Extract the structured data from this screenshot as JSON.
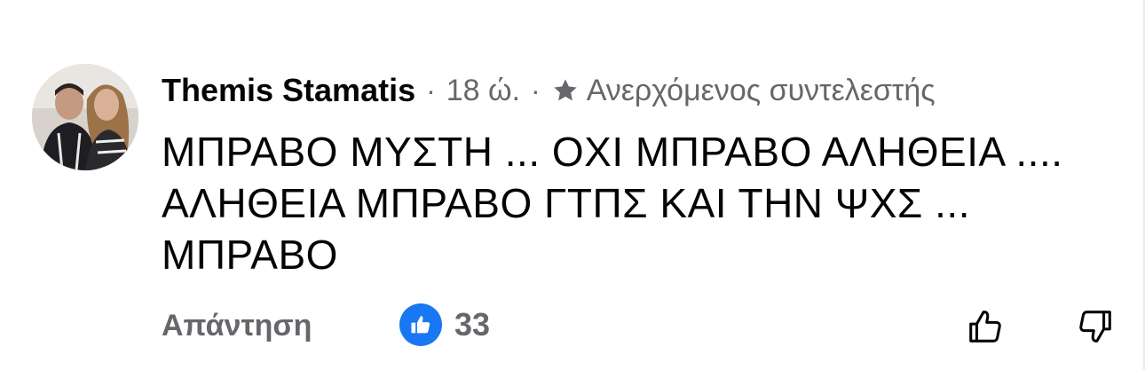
{
  "comment": {
    "author": "Themis Stamatis",
    "time": "18 ώ.",
    "separator": "·",
    "badge": {
      "icon": "star-icon",
      "label": "Ανερχόμενος συντελεστής"
    },
    "text_lines": [
      "ΜΠΡΑΒΟ ΜΥΣΤΗ ... ΟΧΙ ΜΠΡΑΒΟ ΑΛΗΘΕΙΑ ....",
      "ΑΛΗΘΕΙΑ ΜΠΡΑΒΟ ΓΤΠΣ ΚΑΙ ΤΗΝ ΨΧΣ ...",
      "ΜΠΡΑΒΟ"
    ],
    "actions": {
      "reply_label": "Απάντηση",
      "like_count": "33",
      "like_icon": "thumbs-up-icon",
      "upvote_icon": "thumbs-up-outline-icon",
      "downvote_icon": "thumbs-down-outline-icon"
    }
  },
  "colors": {
    "text": "#050505",
    "secondary": "#65676b",
    "like_blue": "#1877f2"
  }
}
